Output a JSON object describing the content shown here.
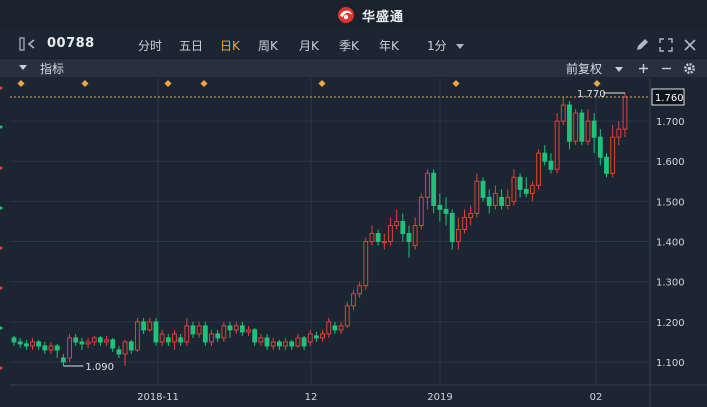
{
  "app": {
    "brand_name": "华盛通"
  },
  "toolbar": {
    "stock_code": "00788",
    "periods": [
      "分时",
      "五日",
      "日K",
      "周K",
      "月K",
      "季K",
      "年K"
    ],
    "active_period": "日K",
    "minute_select": "1分"
  },
  "indicator_bar": {
    "label": "指标",
    "adjust_select": "前复权"
  },
  "chart_data": {
    "type": "candlestick",
    "y_ticks": [
      "1.760",
      "1.700",
      "1.600",
      "1.500",
      "1.400",
      "1.300",
      "1.200",
      "1.100"
    ],
    "ylim": [
      1.07,
      1.79
    ],
    "x_ticks": [
      "2018-11",
      "12",
      "2019",
      "02"
    ],
    "last_price_label": "1.760",
    "high_annotation": "1.770",
    "low_annotation": "1.090",
    "candles": [
      [
        1.16,
        1.15,
        1.165,
        1.14
      ],
      [
        1.15,
        1.145,
        1.16,
        1.135
      ],
      [
        1.145,
        1.14,
        1.155,
        1.13
      ],
      [
        1.14,
        1.15,
        1.16,
        1.13
      ],
      [
        1.15,
        1.14,
        1.155,
        1.13
      ],
      [
        1.14,
        1.13,
        1.15,
        1.12
      ],
      [
        1.13,
        1.14,
        1.15,
        1.12
      ],
      [
        1.14,
        1.13,
        1.145,
        1.11
      ],
      [
        1.11,
        1.1,
        1.12,
        1.09
      ],
      [
        1.11,
        1.16,
        1.17,
        1.1
      ],
      [
        1.16,
        1.15,
        1.17,
        1.14
      ],
      [
        1.15,
        1.145,
        1.16,
        1.13
      ],
      [
        1.145,
        1.15,
        1.16,
        1.135
      ],
      [
        1.15,
        1.16,
        1.165,
        1.14
      ],
      [
        1.16,
        1.15,
        1.165,
        1.14
      ],
      [
        1.15,
        1.155,
        1.165,
        1.14
      ],
      [
        1.155,
        1.135,
        1.16,
        1.125
      ],
      [
        1.13,
        1.12,
        1.14,
        1.11
      ],
      [
        1.12,
        1.15,
        1.155,
        1.09
      ],
      [
        1.15,
        1.13,
        1.155,
        1.12
      ],
      [
        1.13,
        1.2,
        1.21,
        1.125
      ],
      [
        1.2,
        1.18,
        1.21,
        1.17
      ],
      [
        1.18,
        1.2,
        1.21,
        1.175
      ],
      [
        1.2,
        1.15,
        1.21,
        1.14
      ],
      [
        1.15,
        1.17,
        1.18,
        1.14
      ],
      [
        1.16,
        1.15,
        1.17,
        1.14
      ],
      [
        1.15,
        1.17,
        1.18,
        1.13
      ],
      [
        1.16,
        1.15,
        1.17,
        1.14
      ],
      [
        1.15,
        1.19,
        1.21,
        1.14
      ],
      [
        1.19,
        1.17,
        1.2,
        1.16
      ],
      [
        1.17,
        1.19,
        1.2,
        1.16
      ],
      [
        1.19,
        1.15,
        1.2,
        1.14
      ],
      [
        1.15,
        1.17,
        1.18,
        1.14
      ],
      [
        1.17,
        1.16,
        1.18,
        1.15
      ],
      [
        1.16,
        1.19,
        1.2,
        1.15
      ],
      [
        1.19,
        1.18,
        1.2,
        1.16
      ],
      [
        1.18,
        1.19,
        1.2,
        1.17
      ],
      [
        1.19,
        1.175,
        1.2,
        1.165
      ],
      [
        1.175,
        1.18,
        1.19,
        1.165
      ],
      [
        1.18,
        1.15,
        1.185,
        1.14
      ],
      [
        1.15,
        1.16,
        1.17,
        1.14
      ],
      [
        1.16,
        1.14,
        1.17,
        1.13
      ],
      [
        1.14,
        1.15,
        1.16,
        1.13
      ],
      [
        1.15,
        1.14,
        1.155,
        1.13
      ],
      [
        1.14,
        1.15,
        1.16,
        1.13
      ],
      [
        1.15,
        1.14,
        1.155,
        1.13
      ],
      [
        1.14,
        1.16,
        1.17,
        1.135
      ],
      [
        1.16,
        1.14,
        1.165,
        1.13
      ],
      [
        1.15,
        1.17,
        1.18,
        1.14
      ],
      [
        1.165,
        1.16,
        1.175,
        1.15
      ],
      [
        1.16,
        1.17,
        1.18,
        1.15
      ],
      [
        1.17,
        1.2,
        1.21,
        1.16
      ],
      [
        1.19,
        1.18,
        1.2,
        1.17
      ],
      [
        1.18,
        1.19,
        1.2,
        1.17
      ],
      [
        1.19,
        1.24,
        1.25,
        1.185
      ],
      [
        1.24,
        1.27,
        1.28,
        1.23
      ],
      [
        1.27,
        1.29,
        1.3,
        1.26
      ],
      [
        1.29,
        1.4,
        1.41,
        1.28
      ],
      [
        1.4,
        1.42,
        1.44,
        1.39
      ],
      [
        1.42,
        1.4,
        1.43,
        1.39
      ],
      [
        1.4,
        1.4,
        1.42,
        1.38
      ],
      [
        1.4,
        1.44,
        1.46,
        1.39
      ],
      [
        1.44,
        1.45,
        1.48,
        1.43
      ],
      [
        1.45,
        1.42,
        1.47,
        1.4
      ],
      [
        1.42,
        1.4,
        1.44,
        1.36
      ],
      [
        1.39,
        1.44,
        1.46,
        1.38
      ],
      [
        1.44,
        1.51,
        1.52,
        1.43
      ],
      [
        1.51,
        1.57,
        1.58,
        1.48
      ],
      [
        1.57,
        1.49,
        1.58,
        1.47
      ],
      [
        1.49,
        1.48,
        1.52,
        1.45
      ],
      [
        1.48,
        1.47,
        1.51,
        1.44
      ],
      [
        1.47,
        1.4,
        1.48,
        1.38
      ],
      [
        1.4,
        1.43,
        1.46,
        1.38
      ],
      [
        1.43,
        1.46,
        1.48,
        1.42
      ],
      [
        1.46,
        1.47,
        1.49,
        1.44
      ],
      [
        1.47,
        1.55,
        1.57,
        1.46
      ],
      [
        1.55,
        1.51,
        1.56,
        1.5
      ],
      [
        1.51,
        1.49,
        1.53,
        1.47
      ],
      [
        1.49,
        1.52,
        1.54,
        1.48
      ],
      [
        1.51,
        1.49,
        1.53,
        1.48
      ],
      [
        1.49,
        1.51,
        1.53,
        1.48
      ],
      [
        1.5,
        1.56,
        1.58,
        1.49
      ],
      [
        1.56,
        1.53,
        1.57,
        1.51
      ],
      [
        1.53,
        1.52,
        1.56,
        1.51
      ],
      [
        1.52,
        1.54,
        1.55,
        1.5
      ],
      [
        1.54,
        1.62,
        1.63,
        1.53
      ],
      [
        1.62,
        1.6,
        1.64,
        1.59
      ],
      [
        1.6,
        1.58,
        1.62,
        1.57
      ],
      [
        1.58,
        1.7,
        1.72,
        1.57
      ],
      [
        1.7,
        1.74,
        1.76,
        1.69
      ],
      [
        1.74,
        1.65,
        1.75,
        1.63
      ],
      [
        1.65,
        1.72,
        1.73,
        1.64
      ],
      [
        1.72,
        1.65,
        1.73,
        1.64
      ],
      [
        1.65,
        1.7,
        1.73,
        1.64
      ],
      [
        1.7,
        1.66,
        1.72,
        1.62
      ],
      [
        1.66,
        1.61,
        1.68,
        1.59
      ],
      [
        1.61,
        1.57,
        1.62,
        1.56
      ],
      [
        1.57,
        1.66,
        1.69,
        1.56
      ],
      [
        1.66,
        1.68,
        1.7,
        1.64
      ],
      [
        1.68,
        1.76,
        1.77,
        1.66
      ]
    ]
  }
}
